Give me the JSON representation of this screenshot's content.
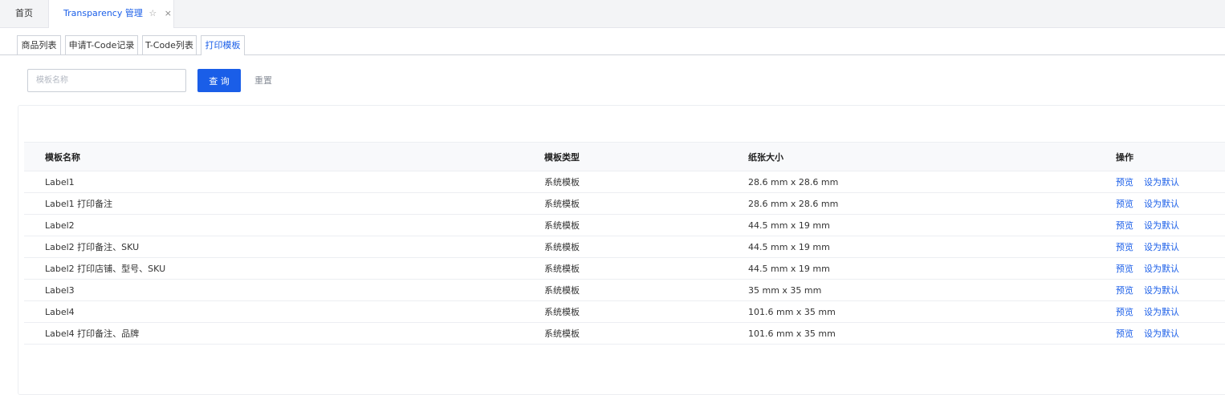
{
  "tabs": {
    "home": "首页",
    "active": "Transparency 管理",
    "star_icon": "☆",
    "close_icon": "×"
  },
  "sub_tabs": [
    "商品列表",
    "申请T-Code记录",
    "T-Code列表",
    "打印模板"
  ],
  "filter": {
    "placeholder": "模板名称",
    "query_label": "查 询",
    "reset_label": "重置"
  },
  "table": {
    "headers": [
      "模板名称",
      "模板类型",
      "纸张大小",
      "操作"
    ],
    "rows": [
      {
        "name": "Label1",
        "type": "系统模板",
        "size": "28.6 mm x 28.6 mm"
      },
      {
        "name": "Label1 打印备注",
        "type": "系统模板",
        "size": "28.6 mm x 28.6 mm"
      },
      {
        "name": "Label2",
        "type": "系统模板",
        "size": "44.5 mm x 19 mm"
      },
      {
        "name": "Label2 打印备注、SKU",
        "type": "系统模板",
        "size": "44.5 mm x 19 mm"
      },
      {
        "name": "Label2 打印店铺、型号、SKU",
        "type": "系统模板",
        "size": "44.5 mm x 19 mm"
      },
      {
        "name": "Label3",
        "type": "系统模板",
        "size": "35 mm x 35 mm"
      },
      {
        "name": "Label4",
        "type": "系统模板",
        "size": "101.6 mm x 35 mm"
      },
      {
        "name": "Label4 打印备注、品牌",
        "type": "系统模板",
        "size": "101.6 mm x 35 mm"
      }
    ],
    "actions": {
      "preview": "预览",
      "set_default": "设为默认"
    }
  },
  "colors": {
    "accent": "#1a5ee8"
  }
}
